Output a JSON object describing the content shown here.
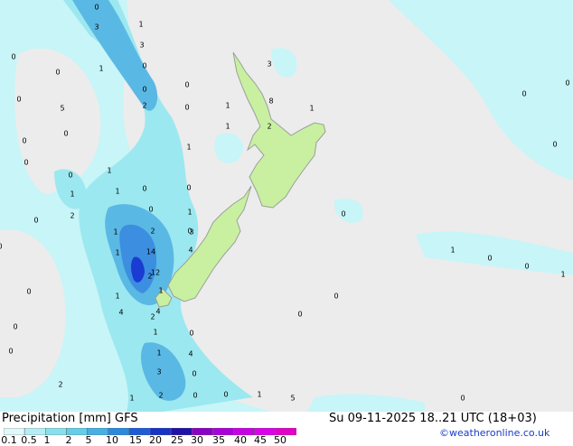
{
  "map": {
    "colors": {
      "background": "#ececec",
      "land": "#c8f0a0",
      "coast": "#9aa09a",
      "p_0_1": "#c8f5f7",
      "p_0_5": "#9ce8f0",
      "p_2": "#78d8ea",
      "p_5": "#5ab8e4",
      "p_10": "#3c8ee0",
      "p_20": "#1a3cd2"
    },
    "values": [
      "0",
      "3",
      "1",
      "3",
      "0",
      "0",
      "1",
      "0",
      "0",
      "5",
      "0",
      "0",
      "2",
      "0",
      "1",
      "1",
      "0",
      "0",
      "1",
      "1",
      "0",
      "0",
      "0",
      "1",
      "0",
      "2",
      "1",
      "0",
      "1",
      "0",
      "2",
      "1",
      "1",
      "0",
      "0",
      "0",
      "0",
      "1",
      "4",
      "2",
      "2",
      "3",
      "4",
      "14",
      "12",
      "1",
      "4",
      "1",
      "0",
      "1",
      "4",
      "0",
      "3",
      "0",
      "1",
      "2",
      "0",
      "1",
      "5",
      "0",
      "2",
      "3",
      "8",
      "2",
      "1",
      "0",
      "0",
      "0",
      "1",
      "0",
      "0",
      "1",
      "0",
      "0",
      "0",
      "0",
      "0",
      "0"
    ]
  },
  "footer": {
    "title": "Precipitation [mm] GFS",
    "datetime": "Su 09-11-2025 18..21 UTC (18+03)",
    "credit": "©weatheronline.co.uk",
    "scale_labels": [
      "0.1",
      "0.5",
      "1",
      "2",
      "5",
      "10",
      "15",
      "20",
      "25",
      "30",
      "35",
      "40",
      "45",
      "50"
    ],
    "scale_colors": [
      "#e0f8fa",
      "#b4eef4",
      "#88e0ee",
      "#64cdea",
      "#46b0e4",
      "#2c8ade",
      "#1e5cd6",
      "#1632c8",
      "#2010a8",
      "#8a00c8",
      "#aa00dc",
      "#c800e6",
      "#dc00ec",
      "#e400c8"
    ]
  }
}
